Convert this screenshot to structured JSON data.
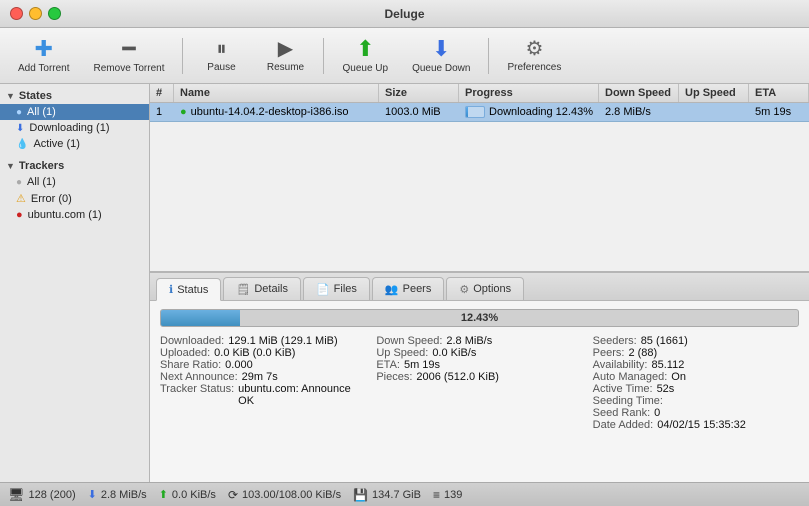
{
  "titlebar": {
    "title": "Deluge"
  },
  "toolbar": {
    "add_label": "Add Torrent",
    "remove_label": "Remove Torrent",
    "pause_label": "Pause",
    "resume_label": "Resume",
    "queue_up_label": "Queue Up",
    "queue_down_label": "Queue Down",
    "preferences_label": "Preferences"
  },
  "sidebar": {
    "states_header": "States",
    "items": [
      {
        "label": "All (1)",
        "active": true
      },
      {
        "label": "Downloading (1)",
        "active": false
      },
      {
        "label": "Active (1)",
        "active": false
      }
    ],
    "trackers_header": "Trackers",
    "tracker_items": [
      {
        "label": "All (1)"
      },
      {
        "label": "Error (0)"
      },
      {
        "label": "ubuntu.com (1)"
      }
    ]
  },
  "torrent_table": {
    "headers": [
      "#",
      "Name",
      "Size",
      "Progress",
      "Down Speed",
      "Up Speed",
      "ETA"
    ],
    "rows": [
      {
        "num": "1",
        "name": "ubuntu-14.04.2-desktop-i386.iso",
        "size": "1003.0 MiB",
        "progress": "Downloading 12.43%",
        "progress_pct": 12.43,
        "down_speed": "2.8 MiB/s",
        "up_speed": "",
        "eta": "5m 19s"
      }
    ]
  },
  "tabs": [
    {
      "label": "Status",
      "active": true
    },
    {
      "label": "Details",
      "active": false
    },
    {
      "label": "Files",
      "active": false
    },
    {
      "label": "Peers",
      "active": false
    },
    {
      "label": "Options",
      "active": false
    }
  ],
  "status_panel": {
    "progress_pct": 12.43,
    "progress_text": "12.43%",
    "fields": {
      "downloaded_label": "Downloaded:",
      "downloaded_value": "129.1 MiB (129.1 MiB)",
      "uploaded_label": "Uploaded:",
      "uploaded_value": "0.0 KiB (0.0 KiB)",
      "share_ratio_label": "Share Ratio:",
      "share_ratio_value": "0.000",
      "next_announce_label": "Next Announce:",
      "next_announce_value": "29m 7s",
      "tracker_status_label": "Tracker Status:",
      "tracker_status_value": "ubuntu.com: Announce OK",
      "down_speed_label": "Down Speed:",
      "down_speed_value": "2.8 MiB/s",
      "up_speed_label": "Up Speed:",
      "up_speed_value": "0.0 KiB/s",
      "eta_label": "ETA:",
      "eta_value": "5m 19s",
      "pieces_label": "Pieces:",
      "pieces_value": "2006 (512.0 KiB)",
      "seeders_label": "Seeders:",
      "seeders_value": "85 (1661)",
      "peers_label": "Peers:",
      "peers_value": "2 (88)",
      "availability_label": "Availability:",
      "availability_value": "85.112",
      "auto_managed_label": "Auto Managed:",
      "auto_managed_value": "On",
      "active_time_label": "Active Time:",
      "active_time_value": "52s",
      "seeding_time_label": "Seeding Time:",
      "seeding_time_value": "",
      "seed_rank_label": "Seed Rank:",
      "seed_rank_value": "0",
      "date_added_label": "Date Added:",
      "date_added_value": "04/02/15 15:35:32"
    }
  },
  "statusbar": {
    "connections": "128 (200)",
    "down_speed": "2.8 MiB/s",
    "up_speed": "0.0 KiB/s",
    "network": "103.00/108.00 KiB/s",
    "disk": "134.7 GiB",
    "queue": "139"
  }
}
